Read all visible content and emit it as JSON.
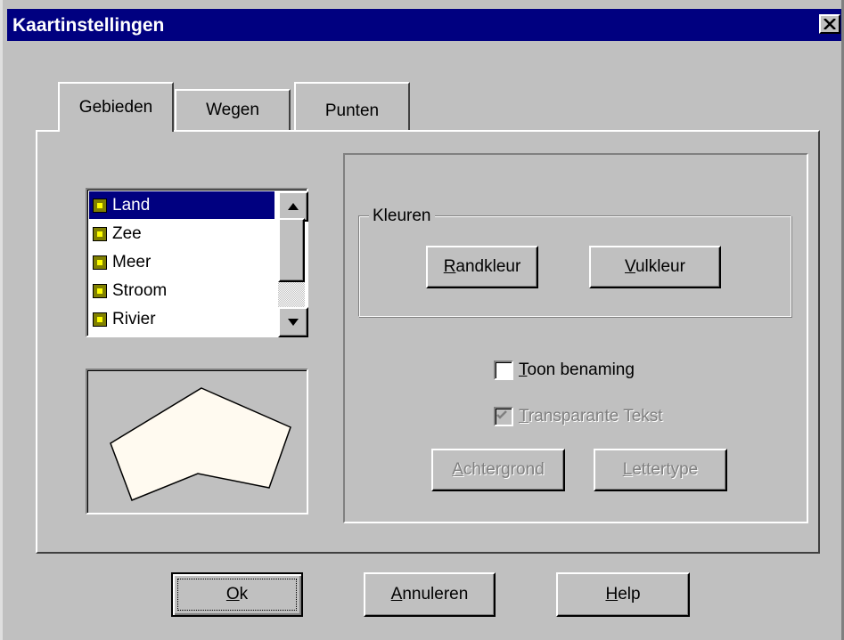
{
  "window": {
    "title": "Kaartinstellingen",
    "close_label": "X"
  },
  "tabs": [
    {
      "label": "Gebieden",
      "active": true
    },
    {
      "label": "Wegen",
      "active": false
    },
    {
      "label": "Punten",
      "active": false
    }
  ],
  "area_list": {
    "items": [
      "Land",
      "Zee",
      "Meer",
      "Stroom",
      "Rivier"
    ],
    "selected": "Land"
  },
  "colors_group": {
    "label": "Kleuren",
    "border_color_button": {
      "mnemonic": "R",
      "rest": "andkleur"
    },
    "fill_color_button": {
      "mnemonic": "V",
      "rest": "ulkleur"
    }
  },
  "options": {
    "show_name": {
      "mnemonic": "T",
      "rest": "oon benaming",
      "checked": false
    },
    "transparent_text": {
      "mnemonic": "T",
      "rest": "ransparante Tekst",
      "checked": true,
      "enabled": false
    }
  },
  "style_buttons": {
    "background": {
      "mnemonic": "A",
      "rest": "chtergrond",
      "enabled": false
    },
    "font": {
      "mnemonic": "L",
      "rest": "ettertype",
      "enabled": false
    }
  },
  "footer": {
    "ok": {
      "mnemonic": "O",
      "rest": "k"
    },
    "cancel": {
      "mnemonic": "A",
      "rest": "nnuleren"
    },
    "help": {
      "mnemonic": "H",
      "rest": "elp"
    }
  },
  "colors": {
    "titlebar": "#000080",
    "face": "#c0c0c0",
    "selection": "#000080",
    "preview_fill": "#fffaf0"
  }
}
